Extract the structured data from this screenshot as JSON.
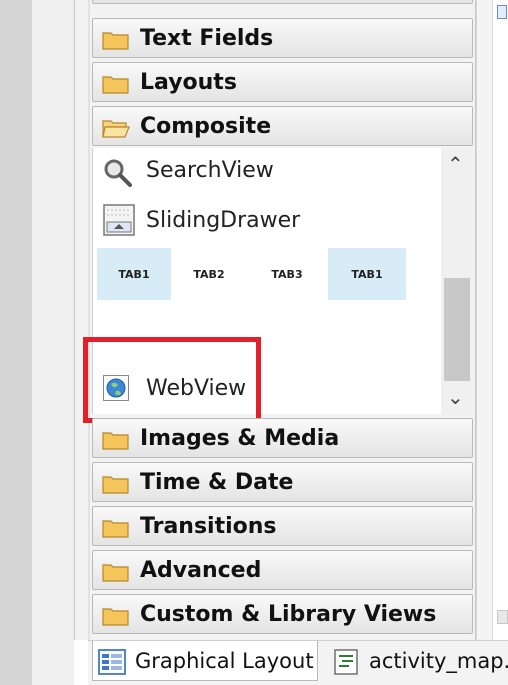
{
  "palette": {
    "categories": [
      {
        "label": "Text Fields",
        "state": "collapsed"
      },
      {
        "label": "Layouts",
        "state": "collapsed"
      },
      {
        "label": "Composite",
        "state": "expanded"
      },
      {
        "label": "Images & Media",
        "state": "collapsed"
      },
      {
        "label": "Time & Date",
        "state": "collapsed"
      },
      {
        "label": "Transitions",
        "state": "collapsed"
      },
      {
        "label": "Advanced",
        "state": "collapsed"
      },
      {
        "label": "Custom & Library Views",
        "state": "collapsed"
      }
    ],
    "composite_items": {
      "search_view": "SearchView",
      "sliding_drawer": "SlidingDrawer",
      "tabs": [
        "TAB1",
        "TAB2",
        "TAB3",
        "TAB1"
      ],
      "web_view": "WebView"
    }
  },
  "editor_tabs": [
    {
      "label": "Graphical Layout"
    },
    {
      "label": "activity_map."
    }
  ],
  "colors": {
    "highlight_box": "#e2202a",
    "tab_highlight": "#d7ecf7",
    "folder": "#f4c55a"
  }
}
